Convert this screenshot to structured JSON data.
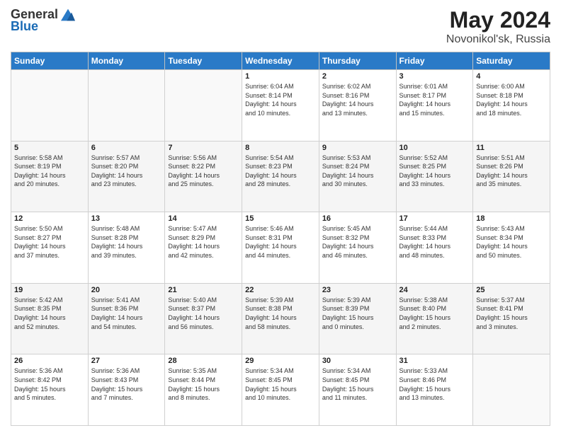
{
  "header": {
    "title": "May 2024",
    "location": "Novonikol'sk, Russia"
  },
  "calendar": {
    "headers": [
      "Sunday",
      "Monday",
      "Tuesday",
      "Wednesday",
      "Thursday",
      "Friday",
      "Saturday"
    ],
    "weeks": [
      [
        {
          "day": "",
          "info": ""
        },
        {
          "day": "",
          "info": ""
        },
        {
          "day": "",
          "info": ""
        },
        {
          "day": "1",
          "info": "Sunrise: 6:04 AM\nSunset: 8:14 PM\nDaylight: 14 hours\nand 10 minutes."
        },
        {
          "day": "2",
          "info": "Sunrise: 6:02 AM\nSunset: 8:16 PM\nDaylight: 14 hours\nand 13 minutes."
        },
        {
          "day": "3",
          "info": "Sunrise: 6:01 AM\nSunset: 8:17 PM\nDaylight: 14 hours\nand 15 minutes."
        },
        {
          "day": "4",
          "info": "Sunrise: 6:00 AM\nSunset: 8:18 PM\nDaylight: 14 hours\nand 18 minutes."
        }
      ],
      [
        {
          "day": "5",
          "info": "Sunrise: 5:58 AM\nSunset: 8:19 PM\nDaylight: 14 hours\nand 20 minutes."
        },
        {
          "day": "6",
          "info": "Sunrise: 5:57 AM\nSunset: 8:20 PM\nDaylight: 14 hours\nand 23 minutes."
        },
        {
          "day": "7",
          "info": "Sunrise: 5:56 AM\nSunset: 8:22 PM\nDaylight: 14 hours\nand 25 minutes."
        },
        {
          "day": "8",
          "info": "Sunrise: 5:54 AM\nSunset: 8:23 PM\nDaylight: 14 hours\nand 28 minutes."
        },
        {
          "day": "9",
          "info": "Sunrise: 5:53 AM\nSunset: 8:24 PM\nDaylight: 14 hours\nand 30 minutes."
        },
        {
          "day": "10",
          "info": "Sunrise: 5:52 AM\nSunset: 8:25 PM\nDaylight: 14 hours\nand 33 minutes."
        },
        {
          "day": "11",
          "info": "Sunrise: 5:51 AM\nSunset: 8:26 PM\nDaylight: 14 hours\nand 35 minutes."
        }
      ],
      [
        {
          "day": "12",
          "info": "Sunrise: 5:50 AM\nSunset: 8:27 PM\nDaylight: 14 hours\nand 37 minutes."
        },
        {
          "day": "13",
          "info": "Sunrise: 5:48 AM\nSunset: 8:28 PM\nDaylight: 14 hours\nand 39 minutes."
        },
        {
          "day": "14",
          "info": "Sunrise: 5:47 AM\nSunset: 8:29 PM\nDaylight: 14 hours\nand 42 minutes."
        },
        {
          "day": "15",
          "info": "Sunrise: 5:46 AM\nSunset: 8:31 PM\nDaylight: 14 hours\nand 44 minutes."
        },
        {
          "day": "16",
          "info": "Sunrise: 5:45 AM\nSunset: 8:32 PM\nDaylight: 14 hours\nand 46 minutes."
        },
        {
          "day": "17",
          "info": "Sunrise: 5:44 AM\nSunset: 8:33 PM\nDaylight: 14 hours\nand 48 minutes."
        },
        {
          "day": "18",
          "info": "Sunrise: 5:43 AM\nSunset: 8:34 PM\nDaylight: 14 hours\nand 50 minutes."
        }
      ],
      [
        {
          "day": "19",
          "info": "Sunrise: 5:42 AM\nSunset: 8:35 PM\nDaylight: 14 hours\nand 52 minutes."
        },
        {
          "day": "20",
          "info": "Sunrise: 5:41 AM\nSunset: 8:36 PM\nDaylight: 14 hours\nand 54 minutes."
        },
        {
          "day": "21",
          "info": "Sunrise: 5:40 AM\nSunset: 8:37 PM\nDaylight: 14 hours\nand 56 minutes."
        },
        {
          "day": "22",
          "info": "Sunrise: 5:39 AM\nSunset: 8:38 PM\nDaylight: 14 hours\nand 58 minutes."
        },
        {
          "day": "23",
          "info": "Sunrise: 5:39 AM\nSunset: 8:39 PM\nDaylight: 15 hours\nand 0 minutes."
        },
        {
          "day": "24",
          "info": "Sunrise: 5:38 AM\nSunset: 8:40 PM\nDaylight: 15 hours\nand 2 minutes."
        },
        {
          "day": "25",
          "info": "Sunrise: 5:37 AM\nSunset: 8:41 PM\nDaylight: 15 hours\nand 3 minutes."
        }
      ],
      [
        {
          "day": "26",
          "info": "Sunrise: 5:36 AM\nSunset: 8:42 PM\nDaylight: 15 hours\nand 5 minutes."
        },
        {
          "day": "27",
          "info": "Sunrise: 5:36 AM\nSunset: 8:43 PM\nDaylight: 15 hours\nand 7 minutes."
        },
        {
          "day": "28",
          "info": "Sunrise: 5:35 AM\nSunset: 8:44 PM\nDaylight: 15 hours\nand 8 minutes."
        },
        {
          "day": "29",
          "info": "Sunrise: 5:34 AM\nSunset: 8:45 PM\nDaylight: 15 hours\nand 10 minutes."
        },
        {
          "day": "30",
          "info": "Sunrise: 5:34 AM\nSunset: 8:45 PM\nDaylight: 15 hours\nand 11 minutes."
        },
        {
          "day": "31",
          "info": "Sunrise: 5:33 AM\nSunset: 8:46 PM\nDaylight: 15 hours\nand 13 minutes."
        },
        {
          "day": "",
          "info": ""
        }
      ]
    ]
  }
}
